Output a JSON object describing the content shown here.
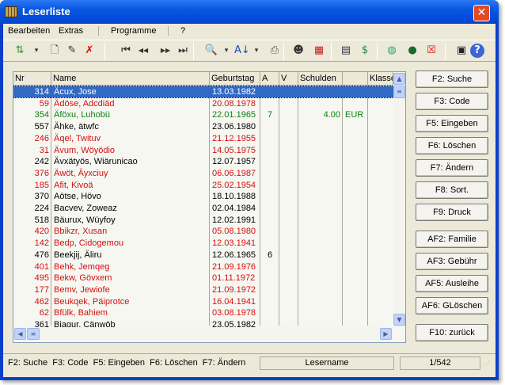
{
  "window": {
    "title": "Leserliste"
  },
  "menu": [
    "Bearbeiten",
    "Extras",
    "Programme",
    "?"
  ],
  "toolbar": [
    "refresh-icon",
    "dropdown-icon",
    "new-icon",
    "edit-icon",
    "delete-icon",
    "first-icon",
    "previous-icon",
    "next-icon",
    "last-icon",
    "search-icon",
    "dropdown-icon",
    "sort-icon",
    "dropdown-icon",
    "print-icon",
    "readers-icon",
    "calendar-icon",
    "schedule-icon",
    "money-icon",
    "internet-icon",
    "globe-icon",
    "cancel-list-icon",
    "save-icon",
    "help-icon"
  ],
  "table": {
    "columns": [
      "Nr",
      "Name",
      "Geburtstag",
      "A",
      "V",
      "Schulden",
      "",
      "Klasse"
    ],
    "rows": [
      {
        "nr": "314",
        "name": "Äcux, Jose",
        "date": "13.03.1982",
        "a": "",
        "s": "",
        "c": "",
        "color": "#000000",
        "selected": true
      },
      {
        "nr": "59",
        "name": "Ädöse, Adcdiäd",
        "date": "20.08.1978",
        "a": "",
        "s": "",
        "c": "",
        "color": "#d01010"
      },
      {
        "nr": "354",
        "name": "Äföxu, Luhobü",
        "date": "22.01.1965",
        "a": "7",
        "s": "4.00",
        "c": "EUR",
        "color": "#108010"
      },
      {
        "nr": "557",
        "name": "Ähke, ätwfc",
        "date": "23.06.1980",
        "a": "",
        "s": "",
        "c": "",
        "color": "#000000"
      },
      {
        "nr": "246",
        "name": "Äqel, Twituv",
        "date": "21.12.1955",
        "a": "",
        "s": "",
        "c": "",
        "color": "#d01010"
      },
      {
        "nr": "31",
        "name": "Ävum, Wöyödio",
        "date": "14.05.1975",
        "a": "",
        "s": "",
        "c": "",
        "color": "#d01010"
      },
      {
        "nr": "242",
        "name": "Ävxätyös, Wiärunicao",
        "date": "12.07.1957",
        "a": "",
        "s": "",
        "c": "",
        "color": "#000000"
      },
      {
        "nr": "376",
        "name": "Äwöt, Äyxciuy",
        "date": "06.06.1987",
        "a": "",
        "s": "",
        "c": "",
        "color": "#d01010"
      },
      {
        "nr": "185",
        "name": "Afit, Kivoä",
        "date": "25.02.1954",
        "a": "",
        "s": "",
        "c": "",
        "color": "#d01010"
      },
      {
        "nr": "370",
        "name": "Aötse, Hövo",
        "date": "18.10.1988",
        "a": "",
        "s": "",
        "c": "",
        "color": "#000000"
      },
      {
        "nr": "224",
        "name": "Bacvev, Zoweaz",
        "date": "02.04.1984",
        "a": "",
        "s": "",
        "c": "",
        "color": "#000000"
      },
      {
        "nr": "518",
        "name": "Bäurux, Wüyfoy",
        "date": "12.02.1991",
        "a": "",
        "s": "",
        "c": "",
        "color": "#000000"
      },
      {
        "nr": "420",
        "name": "Bbikzr, Xusan",
        "date": "05.08.1980",
        "a": "",
        "s": "",
        "c": "",
        "color": "#d01010"
      },
      {
        "nr": "142",
        "name": "Bedp, Cidogemou",
        "date": "12.03.1941",
        "a": "",
        "s": "",
        "c": "",
        "color": "#d01010"
      },
      {
        "nr": "476",
        "name": "Beekjij, Äliru",
        "date": "12.06.1965",
        "a": "6",
        "s": "",
        "c": "",
        "color": "#000000"
      },
      {
        "nr": "401",
        "name": "Behk, Jemqeg",
        "date": "21.09.1976",
        "a": "",
        "s": "",
        "c": "",
        "color": "#d01010"
      },
      {
        "nr": "495",
        "name": "Bekw, Gövxem",
        "date": "01.11.1972",
        "a": "",
        "s": "",
        "c": "",
        "color": "#d01010"
      },
      {
        "nr": "177",
        "name": "Bemv, Jewiofe",
        "date": "21.09.1972",
        "a": "",
        "s": "",
        "c": "",
        "color": "#d01010"
      },
      {
        "nr": "462",
        "name": "Beukqek, Päiprotce",
        "date": "16.04.1941",
        "a": "",
        "s": "",
        "c": "",
        "color": "#d01010"
      },
      {
        "nr": "62",
        "name": "Bfülk, Bahiem",
        "date": "03.08.1978",
        "a": "",
        "s": "",
        "c": "",
        "color": "#d01010"
      },
      {
        "nr": "361",
        "name": "Biaqur, Cänwöb",
        "date": "23.05.1982",
        "a": "",
        "s": "",
        "c": "",
        "color": "#000000"
      }
    ]
  },
  "buttons": [
    "F2: Suche",
    "F3: Code",
    "F5: Eingeben",
    "F6: Löschen",
    "F7: Ändern",
    "F8: Sort.",
    "F9: Druck",
    "AF2: Familie",
    "AF3: Gebühr",
    "AF5: Ausleihe",
    "AF6: GLöschen",
    "F10: zurück"
  ],
  "status": {
    "hints": "F2: Suche  F3: Code  F5: Eingeben  F6: Löschen  F7: Ändern",
    "field": "Lesername",
    "position": "1/542"
  }
}
